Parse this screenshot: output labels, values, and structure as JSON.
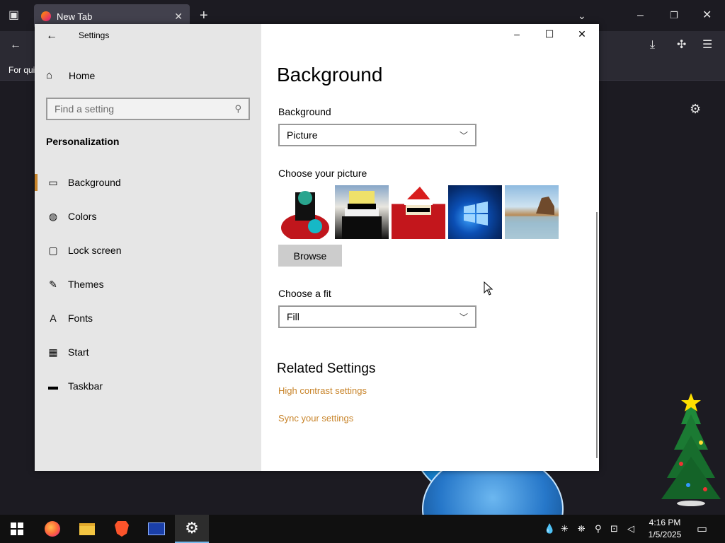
{
  "browser": {
    "tab_title": "New Tab",
    "bookmarks_text": "For qui"
  },
  "settings": {
    "window_title": "Settings",
    "home_label": "Home",
    "search_placeholder": "Find a setting",
    "section_title": "Personalization",
    "nav": [
      {
        "label": "Background",
        "icon": "picture-icon"
      },
      {
        "label": "Colors",
        "icon": "palette-icon"
      },
      {
        "label": "Lock screen",
        "icon": "lock-screen-icon"
      },
      {
        "label": "Themes",
        "icon": "themes-icon"
      },
      {
        "label": "Fonts",
        "icon": "fonts-icon"
      },
      {
        "label": "Start",
        "icon": "start-icon"
      },
      {
        "label": "Taskbar",
        "icon": "taskbar-icon"
      }
    ],
    "page_title": "Background",
    "background_label": "Background",
    "background_value": "Picture",
    "choose_picture_label": "Choose your picture",
    "browse_label": "Browse",
    "choose_fit_label": "Choose a fit",
    "fit_value": "Fill",
    "related_title": "Related Settings",
    "related_links": [
      "High contrast settings",
      "Sync your settings"
    ]
  },
  "taskbar": {
    "time": "4:16 PM",
    "date": "1/5/2025"
  },
  "colors": {
    "accent": "#c8842a",
    "sidebar_bg": "#e6e6e6"
  }
}
